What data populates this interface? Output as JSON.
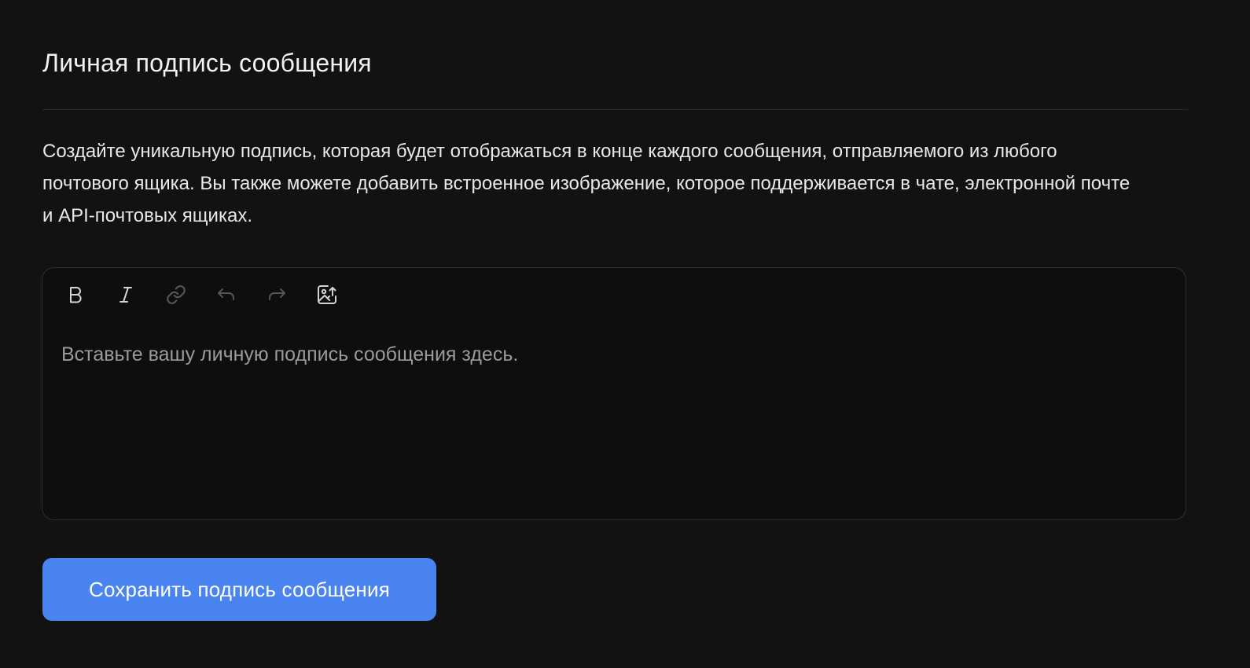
{
  "header": {
    "title": "Личная подпись сообщения"
  },
  "description": {
    "text": "Создайте уникальную подпись, которая будет отображаться в конце каждого сообщения, отправляемого из любого почтового ящика. Вы также можете добавить встроенное изображение, которое поддерживается в чате, электронной почте и API-почтовых ящиках."
  },
  "editor": {
    "placeholder": "Вставьте вашу личную подпись сообщения здесь.",
    "toolbar": [
      {
        "icon": "bold-icon",
        "enabled": true
      },
      {
        "icon": "italic-icon",
        "enabled": true
      },
      {
        "icon": "link-icon",
        "enabled": false
      },
      {
        "icon": "undo-icon",
        "enabled": false
      },
      {
        "icon": "redo-icon",
        "enabled": false
      },
      {
        "icon": "image-upload-icon",
        "enabled": true
      }
    ]
  },
  "actions": {
    "save_label": "Сохранить подпись сообщения"
  },
  "colors": {
    "background": "#121212",
    "editor_background": "#0e0e0e",
    "accent": "#4a84f0",
    "icon_active": "#d4d4d4",
    "icon_disabled": "#555555"
  }
}
